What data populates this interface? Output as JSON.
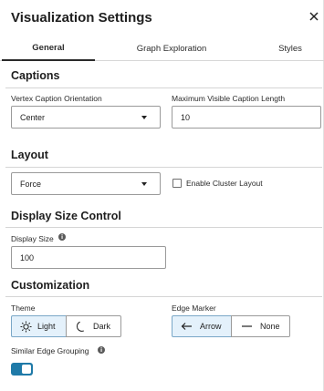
{
  "header": {
    "title": "Visualization Settings",
    "close_icon": "close-icon"
  },
  "tabs": [
    {
      "label": "General",
      "active": true
    },
    {
      "label": "Graph Exploration",
      "active": false
    },
    {
      "label": "Styles",
      "active": false
    }
  ],
  "captions": {
    "title": "Captions",
    "orientation_label": "Vertex Caption Orientation",
    "orientation_value": "Center",
    "max_length_label": "Maximum Visible Caption Length",
    "max_length_value": "10"
  },
  "layout": {
    "title": "Layout",
    "layout_value": "Force",
    "cluster_label": "Enable Cluster Layout",
    "cluster_checked": false
  },
  "display_size": {
    "title": "Display Size Control",
    "label": "Display Size",
    "info_icon": "info-icon",
    "value": "100"
  },
  "customization": {
    "title": "Customization",
    "theme_label": "Theme",
    "theme_options": [
      {
        "label": "Light",
        "icon": "sun-icon",
        "selected": true
      },
      {
        "label": "Dark",
        "icon": "moon-icon",
        "selected": false
      }
    ],
    "edge_marker_label": "Edge Marker",
    "edge_marker_options": [
      {
        "label": "Arrow",
        "icon": "arrow-left-icon",
        "selected": true
      },
      {
        "label": "None",
        "icon": "dash-icon",
        "selected": false
      }
    ],
    "edge_grouping_label": "Similar Edge Grouping",
    "edge_grouping_on": true
  },
  "colors": {
    "accent": "#1f7aa8",
    "selected_bg": "#e4f1fb",
    "border": "#9a9a9a"
  }
}
